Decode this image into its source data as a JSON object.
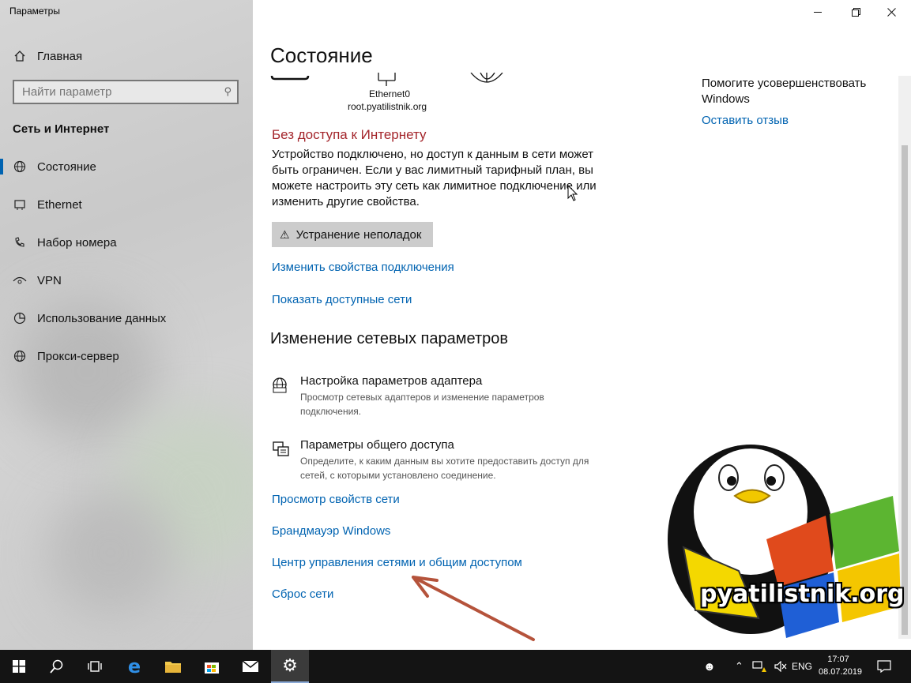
{
  "window": {
    "title": "Параметры"
  },
  "sidebar": {
    "home_label": "Главная",
    "search_placeholder": "Найти параметр",
    "section_title": "Сеть и Интернет",
    "items": [
      {
        "label": "Состояние",
        "icon": "globe-icon"
      },
      {
        "label": "Ethernet",
        "icon": "ethernet-icon"
      },
      {
        "label": "Набор номера",
        "icon": "dialup-icon"
      },
      {
        "label": "VPN",
        "icon": "vpn-icon"
      },
      {
        "label": "Использование данных",
        "icon": "data-usage-icon"
      },
      {
        "label": "Прокси-сервер",
        "icon": "globe-icon"
      }
    ]
  },
  "main": {
    "title": "Состояние",
    "diagram": {
      "adapter": "Ethernet0",
      "domain": "root.pyatilistnik.org"
    },
    "status_title": "Без доступа к Интернету",
    "status_desc": "Устройство подключено, но доступ к данным в сети может быть ограничен. Если у вас лимитный тарифный план, вы можете настроить эту сеть как лимитное подключение или изменить другие свойства.",
    "troubleshoot_label": "Устранение неполадок",
    "link_change_props": "Изменить свойства подключения",
    "link_show_networks": "Показать доступные сети",
    "change_section_title": "Изменение сетевых параметров",
    "adapter_title": "Настройка параметров адаптера",
    "adapter_desc": "Просмотр сетевых адаптеров и изменение параметров подключения.",
    "sharing_title": "Параметры общего доступа",
    "sharing_desc": "Определите, к каким данным вы хотите предоставить доступ для сетей, с которыми установлено соединение.",
    "link_view_props": "Просмотр свойств сети",
    "link_firewall": "Брандмауэр Windows",
    "link_network_center": "Центр управления сетями и общим доступом",
    "link_reset": "Сброс сети"
  },
  "aside": {
    "help_title": "Помогите усовершенствовать Windows",
    "feedback_link": "Оставить отзыв"
  },
  "watermark": {
    "text": "pyatilistnik.org"
  },
  "taskbar": {
    "lang": "ENG",
    "time": "17:07",
    "date": "08.07.2019"
  },
  "colors": {
    "accent": "#0063b1",
    "error": "#a4262c",
    "arrow": "#b5533b"
  }
}
